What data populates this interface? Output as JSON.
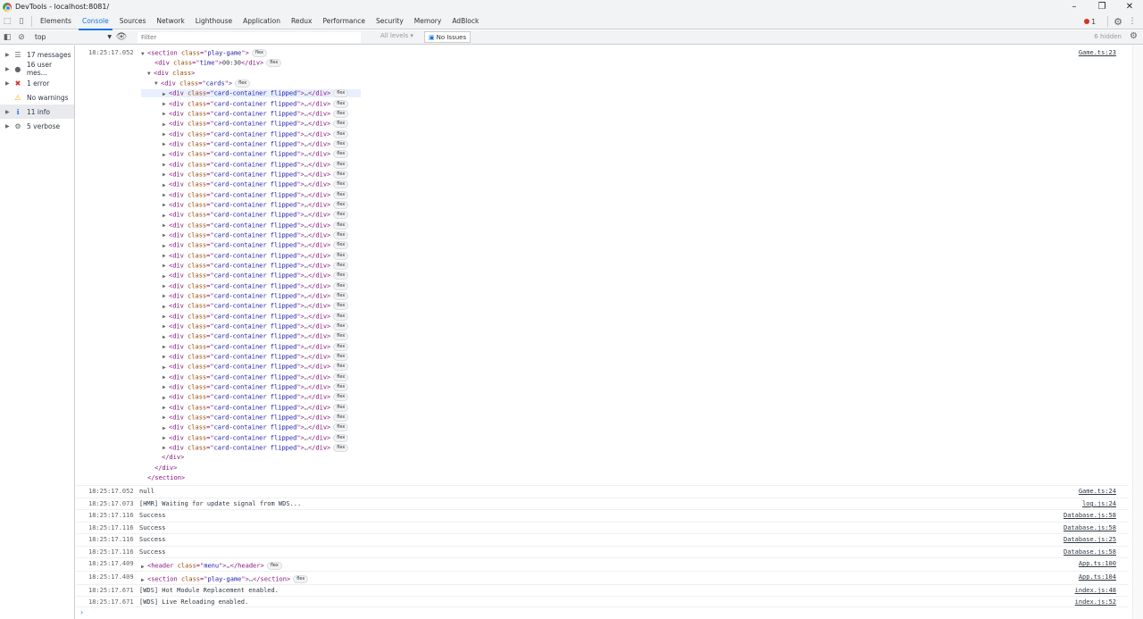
{
  "window": {
    "title": "DevTools - localhost:8081/"
  },
  "tabs": [
    "Elements",
    "Console",
    "Sources",
    "Network",
    "Lighthouse",
    "Application",
    "Redux",
    "Performance",
    "Security",
    "Memory",
    "AdBlock"
  ],
  "active_tab": "Console",
  "error_badge": "1",
  "toolbar": {
    "context": "top",
    "filter_placeholder": "Filter",
    "levels": "All levels ▾",
    "issues": "No Issues",
    "hidden": "6 hidden"
  },
  "sidebar": [
    {
      "icon": "list-icon",
      "label": "17 messages"
    },
    {
      "icon": "user-icon",
      "label": "16 user mes..."
    },
    {
      "icon": "error-icon",
      "label": "1 error"
    },
    {
      "icon": "warning-icon",
      "label": "No warnings"
    },
    {
      "icon": "info-icon",
      "label": "11 info",
      "selected": true
    },
    {
      "icon": "verbose-icon",
      "label": "5 verbose"
    }
  ],
  "first_message": {
    "timestamp": "18:25:17.052",
    "source": "Game.ts:23",
    "section_class": "play-game",
    "time_class": "time",
    "time_value": "00:30",
    "cards_class": "cards",
    "card_class": "card-container flipped",
    "card_count": 36,
    "flex_label": "flex",
    "ellipsis": "…"
  },
  "messages": [
    {
      "timestamp": "18:25:17.052",
      "text": "null",
      "source": "Game.ts:24"
    },
    {
      "timestamp": "18:25:17.073",
      "text": "[HMR] Waiting for update signal from WDS...",
      "source": "log.js:24"
    },
    {
      "timestamp": "18:25:17.116",
      "text": "Success",
      "source": "Database.js:58"
    },
    {
      "timestamp": "18:25:17.116",
      "text": "Success",
      "source": "Database.js:58"
    },
    {
      "timestamp": "18:25:17.116",
      "text": "Success",
      "source": "Database.js:25"
    },
    {
      "timestamp": "18:25:17.116",
      "text": "Success",
      "source": "Database.js:58"
    },
    {
      "timestamp": "18:25:17.409",
      "element": {
        "tag": "header",
        "cls": "menu"
      },
      "source": "App.ts:100"
    },
    {
      "timestamp": "18:25:17.409",
      "element": {
        "tag": "section",
        "cls": "play-game"
      },
      "source": "App.ts:104"
    },
    {
      "timestamp": "18:25:17.671",
      "text": "[WDS] Hot Module Replacement enabled.",
      "source": "index.js:48"
    },
    {
      "timestamp": "18:25:17.671",
      "text": "[WDS] Live Reloading enabled.",
      "source": "index.js:52"
    }
  ]
}
